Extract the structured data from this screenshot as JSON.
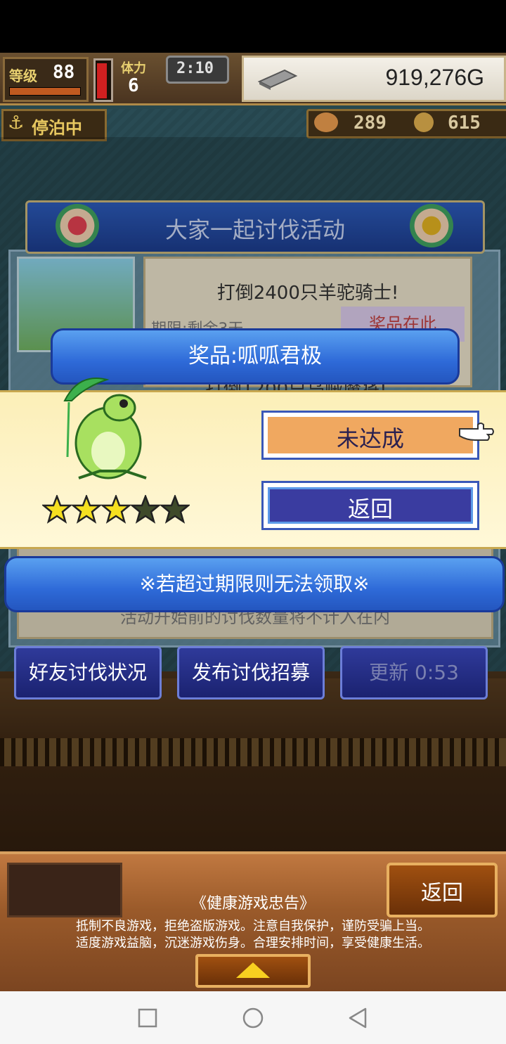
{
  "hud": {
    "level_label": "等级",
    "level_value": "88",
    "stamina_label": "体力",
    "stamina_value": "6",
    "timer": "2:10",
    "gold": "919,276G",
    "status": "停泊中",
    "medals": "289",
    "coins": "615"
  },
  "event": {
    "title": "大家一起讨伐活动",
    "task1": "打倒2400只羊驼骑士!",
    "period_partial": "期限:剩余3天",
    "reward_tag_partial": "奖品在此",
    "task2_partial": "打倒1200只乌贼魔将!",
    "footer_partial": "活动开始前的讨伐数量将不计入在内"
  },
  "modal": {
    "title": "奖品:呱呱君极",
    "status_button": "未达成",
    "back_button": "返回",
    "rating": 3,
    "rating_max": 5,
    "notice": "※若超过期限则无法领取※"
  },
  "actions": {
    "friends": "好友讨伐状况",
    "recruit": "发布讨伐招募",
    "refresh": "更新 0:53"
  },
  "footer": {
    "back": "返回",
    "health_title": "《健康游戏忠告》",
    "health_line1": "抵制不良游戏，拒绝盗版游戏。注意自我保护，谨防受骗上当。",
    "health_line2": "适度游戏益脑，沉迷游戏伤身。合理安排时间，享受健康生活。"
  },
  "colors": {
    "modal_bg": "#fdf3c4",
    "status_button_bg": "#f0a860",
    "star_on": "#f5e020",
    "star_off": "#3e4a2a"
  }
}
